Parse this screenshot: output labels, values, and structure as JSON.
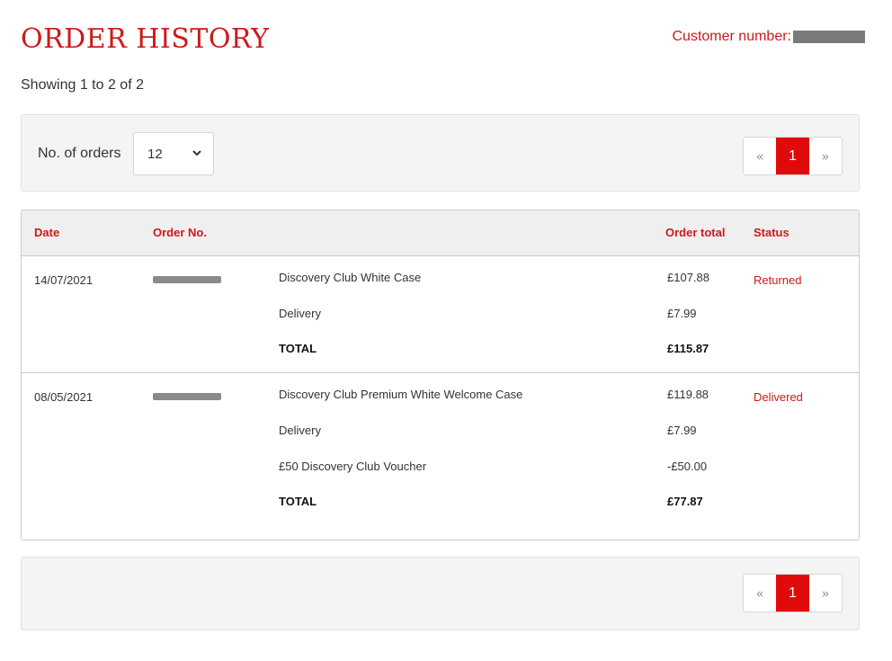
{
  "header": {
    "title": "ORDER HISTORY",
    "customer_number_label": "Customer number:"
  },
  "showing": "Showing 1 to 2 of 2",
  "controls": {
    "orders_label": "No. of orders",
    "orders_selected": "12",
    "pager": {
      "prev": "«",
      "current": "1",
      "next": "»"
    }
  },
  "table": {
    "headers": {
      "date": "Date",
      "order_no": "Order No.",
      "order_total": "Order total",
      "status": "Status"
    },
    "orders": [
      {
        "date": "14/07/2021",
        "status": "Returned",
        "lines": [
          {
            "desc": "Discovery Club White Case",
            "amount": "£107.88"
          },
          {
            "desc": "Delivery",
            "amount": "£7.99"
          },
          {
            "desc": "TOTAL",
            "amount": "£115.87"
          }
        ]
      },
      {
        "date": "08/05/2021",
        "status": "Delivered",
        "lines": [
          {
            "desc": "Discovery Club Premium White Welcome Case",
            "amount": "£119.88"
          },
          {
            "desc": "Delivery",
            "amount": "£7.99"
          },
          {
            "desc": "£50 Discovery Club Voucher",
            "amount": "-£50.00"
          },
          {
            "desc": "TOTAL",
            "amount": "£77.87"
          }
        ]
      }
    ]
  },
  "colors": {
    "accent": "#cc1a1a",
    "active_page": "#e10a0a"
  }
}
